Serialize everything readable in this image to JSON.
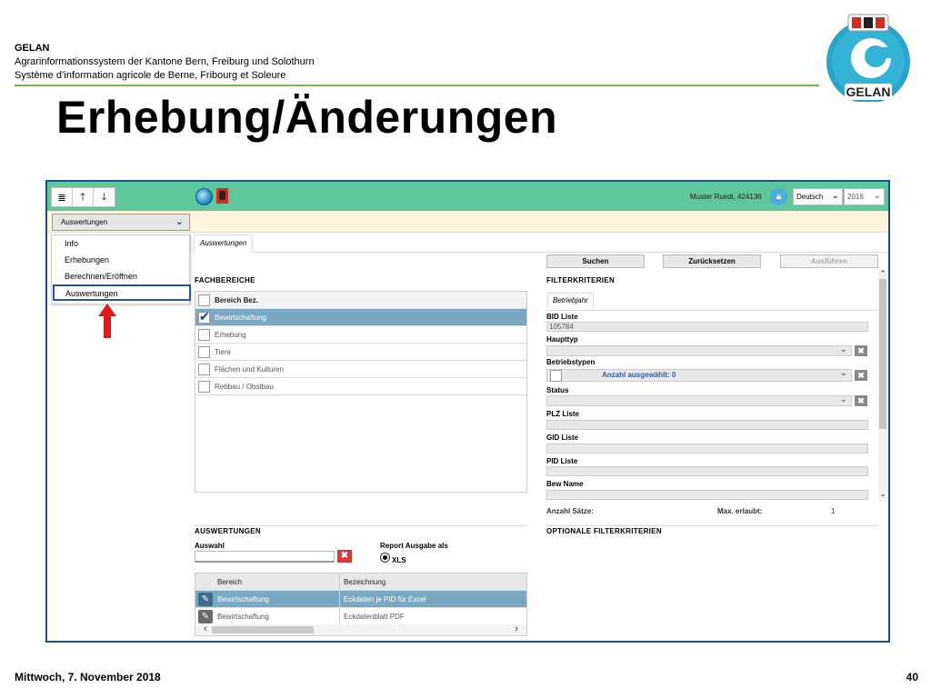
{
  "slide": {
    "org_name": "GELAN",
    "org_line_de": "Agrarinformationssystem der Kantone Bern, Freiburg und Solothurn",
    "org_line_fr": "Système d’information agricole de Berne, Fribourg et Soleure",
    "title": "Erhebung/Änderungen",
    "logo_text": "GELAN",
    "footer_date": "Mittwoch, 7. November 2018",
    "page_number": "40"
  },
  "app": {
    "user": "Muster Ruedi, 424136",
    "language": "Deutsch",
    "year": "2018",
    "module_select": "Auswertungen",
    "menu": [
      {
        "label": "Info"
      },
      {
        "label": "Erhebungen"
      },
      {
        "label": "Berechnen/Eröffnen"
      },
      {
        "label": "Auswertungen"
      }
    ],
    "active_tab": "Auswertungen",
    "fachbereiche": {
      "title": "Fachbereiche",
      "header": "Bereich Bez.",
      "rows": [
        {
          "label": "Bewirtschaftung",
          "checked": true
        },
        {
          "label": "Erhebung",
          "checked": false
        },
        {
          "label": "Tiere",
          "checked": false
        },
        {
          "label": "Flächen und Kulturen",
          "checked": false
        },
        {
          "label": "Rebbau / Obstbau",
          "checked": false
        }
      ]
    },
    "buttons": {
      "search": "Suchen",
      "reset": "Zurücksetzen",
      "run": "Ausführen"
    },
    "filter": {
      "title": "Filterkriterien",
      "tab": "Betriebjahr",
      "bid_label": "BID Liste",
      "bid_value": "105784",
      "haupttyp_label": "Haupttyp",
      "betriebstypen_label": "Betriebstypen",
      "betriebstypen_value": "Anzahl ausgewählt: 0",
      "status_label": "Status",
      "plz_label": "PLZ Liste",
      "gid_label": "GID Liste",
      "pid_label": "PID Liste",
      "bew_label": "Bew Name"
    },
    "counts": {
      "anzahl_label": "Anzahl Sätze:",
      "max_label": "Max. erlaubt:",
      "max_value": "1"
    },
    "optional_title": "Optionale Filterkriterien",
    "auswertungen": {
      "title": "Auswertungen",
      "auswahl_label": "Auswahl",
      "report_label": "Report Ausgabe als",
      "report_option": "XLS",
      "columns": [
        "Bereich",
        "Bezeichnung"
      ],
      "rows": [
        {
          "bereich": "Bewirtschaftung",
          "bezeichnung": "Eckdaten je PID für Excel"
        },
        {
          "bereich": "Bewirtschaftung",
          "bezeichnung": "Eckdatenblatt PDF"
        }
      ]
    }
  }
}
